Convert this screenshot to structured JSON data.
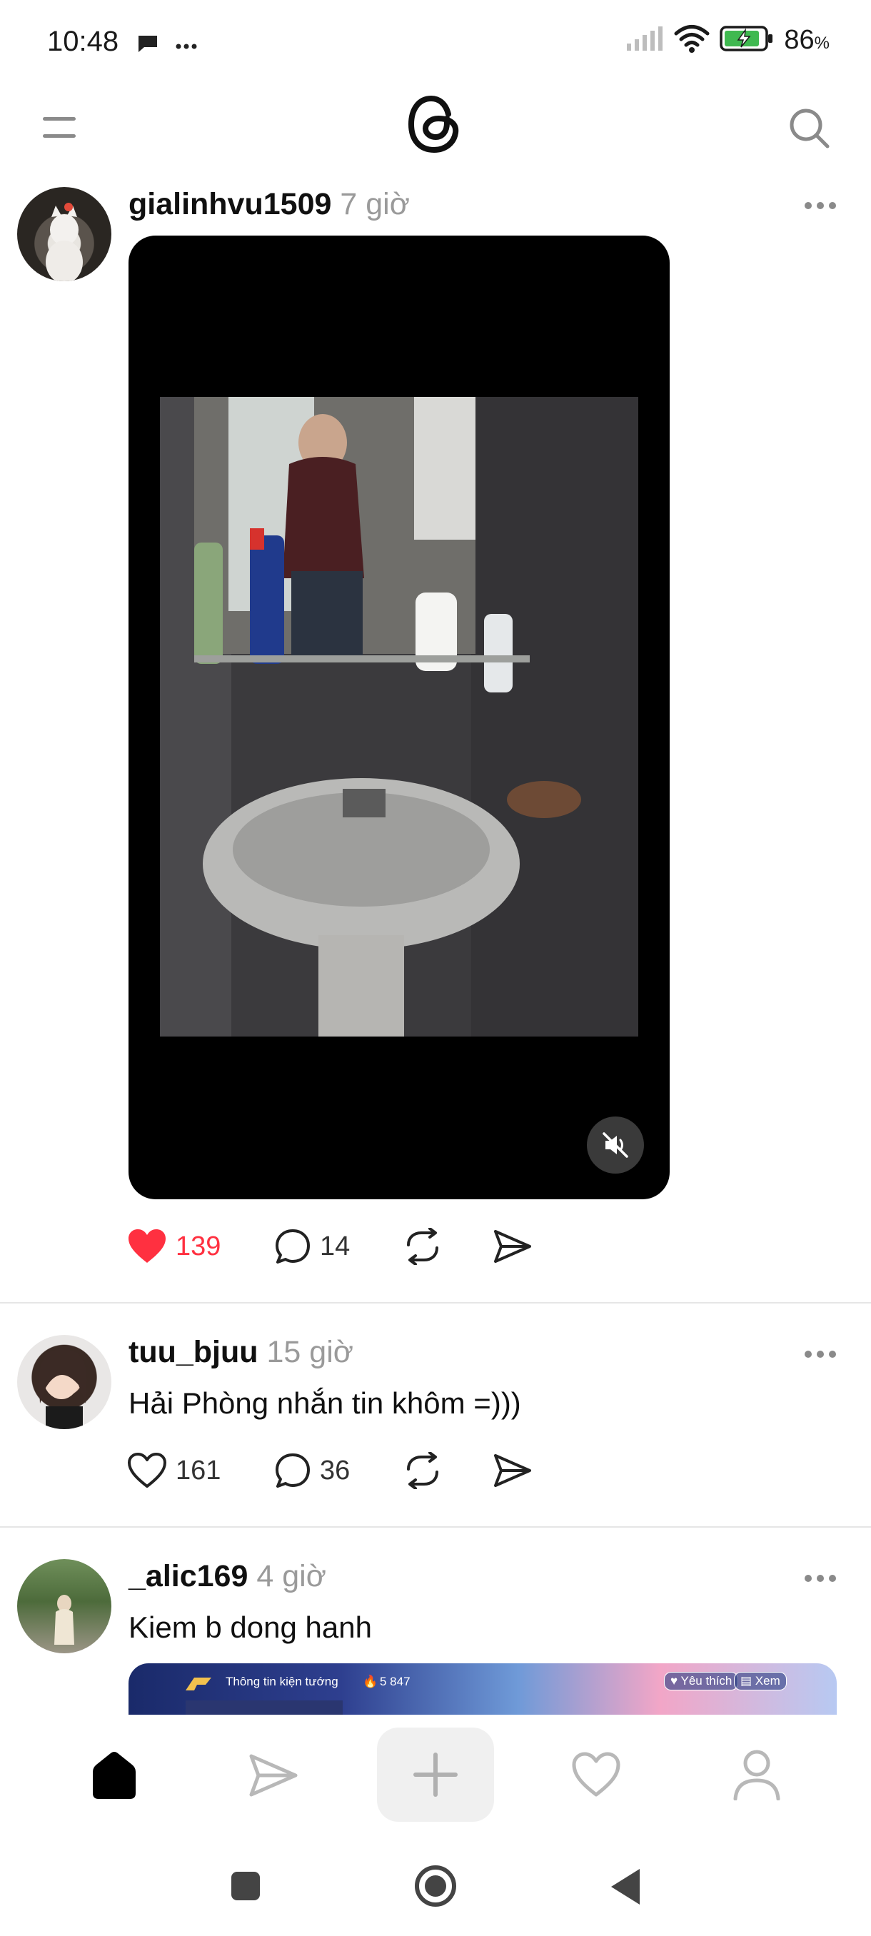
{
  "status_bar": {
    "time": "10:48",
    "battery_percent": "86",
    "battery_symbol": "%"
  },
  "header": {
    "menu_icon": "menu-icon",
    "logo_icon": "threads-logo",
    "search_icon": "search-icon"
  },
  "posts": [
    {
      "username": "gialinhvu1509",
      "time": "7 giờ",
      "text": "",
      "media": "video",
      "likes": "139",
      "liked": true,
      "comments": "14"
    },
    {
      "username": "tuu_bjuu",
      "time": "15 giờ",
      "text": "Hải Phòng nhắn tin khôm =)))",
      "media": "none",
      "likes": "161",
      "liked": false,
      "comments": "36"
    },
    {
      "username": "_alic169",
      "time": "4 giờ",
      "text": "Kiem b dong hanh",
      "media": "image",
      "banner": {
        "title": "Thông tin kiện tướng",
        "count": "5 847",
        "like_label": "Yêu thích",
        "view_label": "Xem"
      }
    }
  ],
  "colors": {
    "like_red": "#ff3040",
    "muted_text": "#9a9a9a",
    "divider": "#e6e6e6"
  }
}
